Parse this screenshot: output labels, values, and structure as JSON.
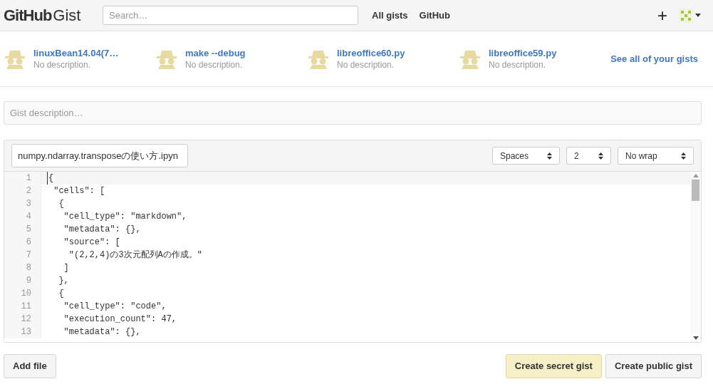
{
  "header": {
    "logo_bold": "GitHub",
    "logo_light": "Gist",
    "search": {
      "placeholder": "Search…"
    },
    "nav": [
      "All gists",
      "GitHub"
    ],
    "plus": "+"
  },
  "recent_gists": [
    {
      "name": "linuxBean14.04(7…",
      "description": "No description."
    },
    {
      "name": "make --debug",
      "description": "No description."
    },
    {
      "name": "libreoffice60.py",
      "description": "No description."
    },
    {
      "name": "libreoffice59.py",
      "description": "No description."
    }
  ],
  "see_all": "See all of your gists",
  "description_field": {
    "placeholder": "Gist description…"
  },
  "editor": {
    "filename": "numpy.ndarray.transposeの使い方.ipyn",
    "selects": [
      "Spaces",
      "2",
      "No wrap"
    ],
    "lines": [
      {
        "number": "1",
        "text": "{",
        "selected": true
      },
      {
        "number": "2",
        "text": " \"cells\": [",
        "selected": false
      },
      {
        "number": "3",
        "text": "  {",
        "selected": false
      },
      {
        "number": "4",
        "text": "   \"cell_type\": \"markdown\",",
        "selected": false
      },
      {
        "number": "5",
        "text": "   \"metadata\": {},",
        "selected": false
      },
      {
        "number": "6",
        "text": "   \"source\": [",
        "selected": false
      },
      {
        "number": "7",
        "text": "    \"(2,2,4)の3次元配列Aの作成。\"",
        "selected": false
      },
      {
        "number": "8",
        "text": "   ]",
        "selected": false
      },
      {
        "number": "9",
        "text": "  },",
        "selected": false
      },
      {
        "number": "10",
        "text": "  {",
        "selected": false
      },
      {
        "number": "11",
        "text": "   \"cell_type\": \"code\",",
        "selected": false
      },
      {
        "number": "12",
        "text": "   \"execution_count\": 47,",
        "selected": false
      },
      {
        "number": "13",
        "text": "   \"metadata\": {},",
        "selected": false
      }
    ]
  },
  "buttons": [
    {
      "label": "Add file",
      "kind": "plain"
    },
    {
      "label": "Create secret gist",
      "kind": "primary"
    },
    {
      "label": "Create public gist",
      "kind": "plain"
    }
  ]
}
